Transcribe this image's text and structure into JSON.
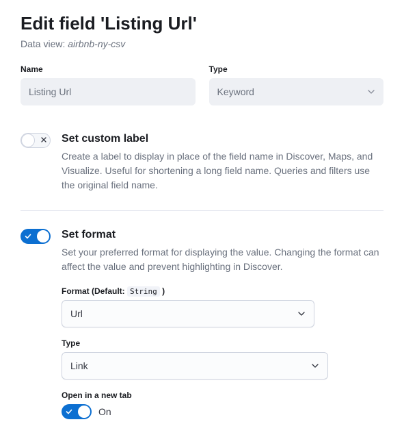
{
  "header": {
    "title": "Edit field 'Listing Url'",
    "subtitle_prefix": "Data view: ",
    "subtitle_value": "airbnb-ny-csv"
  },
  "fields": {
    "name_label": "Name",
    "name_value": "Listing Url",
    "type_label": "Type",
    "type_value": "Keyword"
  },
  "custom_label": {
    "title": "Set custom label",
    "desc": "Create a label to display in place of the field name in Discover, Maps, and Visualize. Useful for shortening a long field name. Queries and filters use the original field name."
  },
  "format": {
    "title": "Set format",
    "desc": "Set your preferred format for displaying the value. Changing the format can affect the value and prevent highlighting in Discover.",
    "format_label_prefix": "Format (Default: ",
    "format_label_code": "String",
    "format_label_suffix": " )",
    "format_value": "Url",
    "type_label": "Type",
    "type_value": "Link",
    "new_tab_label": "Open in a new tab",
    "new_tab_status": "On"
  }
}
